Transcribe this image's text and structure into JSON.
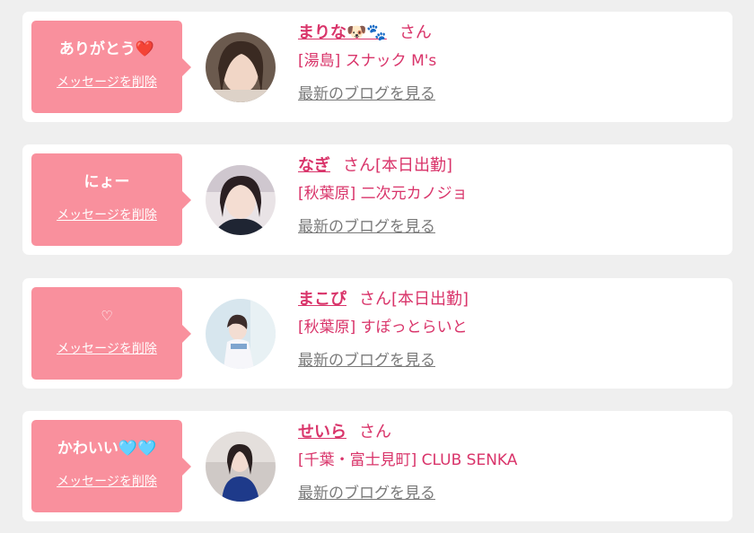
{
  "delete_label": "メッセージを削除",
  "blog_label": "最新のブログを見る",
  "colors": {
    "accent": "#d9346a",
    "bubble": "#f9909d",
    "link_gray": "#7a7a7a"
  },
  "cards": [
    {
      "message": "ありがとう❤️",
      "name": "まりな🐶🐾",
      "suffix": "さん",
      "shop": "[湯島] スナック M's"
    },
    {
      "message": "にょー",
      "name": "なぎ",
      "suffix": "さん[本日出勤]",
      "shop": "[秋葉原] 二次元カノジョ"
    },
    {
      "message": "♡",
      "name": "まこぴ",
      "suffix": "さん[本日出勤]",
      "shop": "[秋葉原] すぽっとらいと"
    },
    {
      "message": "かわいい🩵🩵",
      "name": "せいら",
      "suffix": "さん",
      "shop": "[千葉・富士見町] CLUB SENKA"
    }
  ]
}
